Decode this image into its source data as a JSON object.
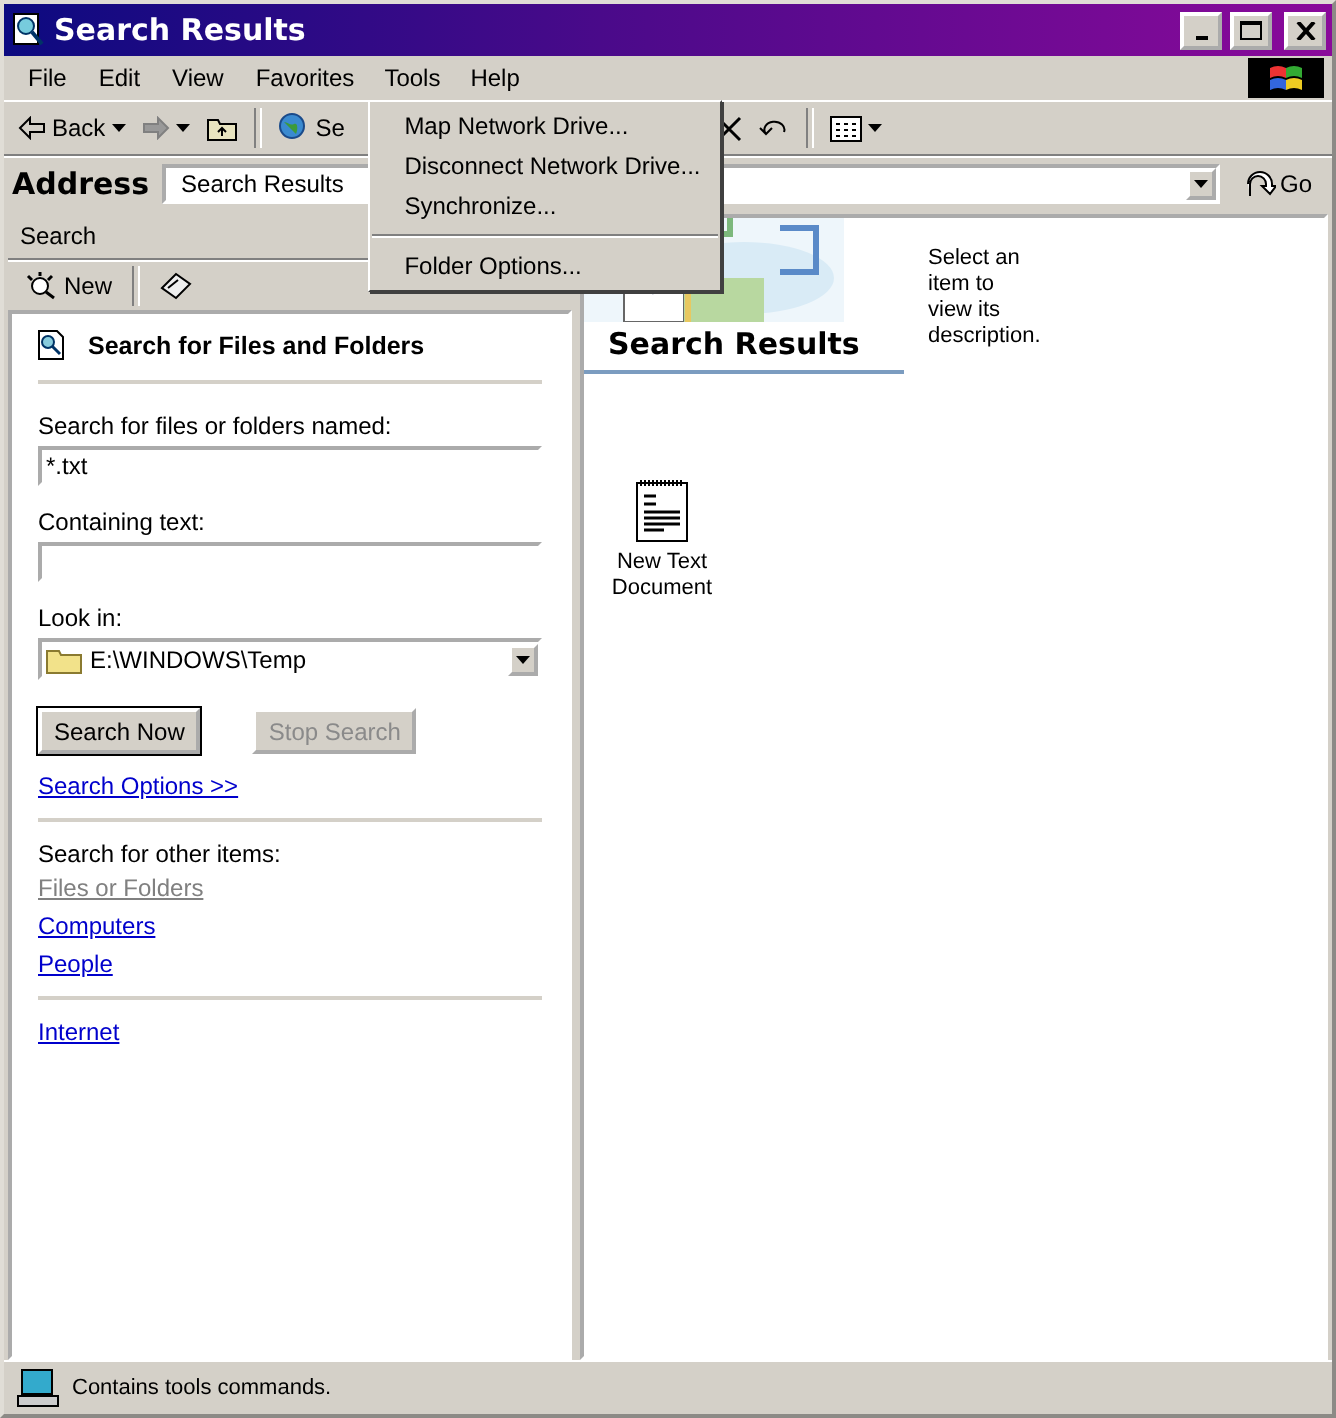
{
  "window": {
    "title": "Search Results"
  },
  "menu_bar": [
    {
      "label": "File",
      "selected": false
    },
    {
      "label": "Edit",
      "selected": false
    },
    {
      "label": "View",
      "selected": false
    },
    {
      "label": "Favorites",
      "selected": false
    },
    {
      "label": "Tools",
      "selected": true
    },
    {
      "label": "Help",
      "selected": false
    }
  ],
  "open_menu": {
    "items": [
      {
        "kind": "item",
        "label": "Map Network Drive..."
      },
      {
        "kind": "item",
        "label": "Disconnect Network Drive..."
      },
      {
        "kind": "item",
        "label": "Synchronize..."
      },
      {
        "kind": "separator"
      },
      {
        "kind": "item",
        "label": "Folder Options..."
      }
    ]
  },
  "toolbar": [
    {
      "kind": "back",
      "label": "Back",
      "disabled": false
    },
    {
      "kind": "forward",
      "disabled": true
    },
    {
      "kind": "up",
      "disabled": false
    },
    {
      "kind": "search",
      "label": "Se",
      "disabled": false
    },
    {
      "kind": "delete",
      "disabled": false
    },
    {
      "kind": "undo",
      "disabled": false
    },
    {
      "kind": "views",
      "disabled": false
    }
  ],
  "address": {
    "label": "Address",
    "value": "Search Results",
    "go": "Go"
  },
  "search_pane": {
    "title": "Search",
    "new_button": "New",
    "heading": "Search for Files and Folders",
    "fields": [
      {
        "label": "Search for files or folders named:",
        "value": "*.txt"
      },
      {
        "label": "Containing text:"
      }
    ],
    "look_in": {
      "label": "Look in:",
      "value": "E:\\WINDOWS\\Temp"
    },
    "buttons": [
      {
        "label": "Search Now",
        "disabled": false
      },
      {
        "label": "Stop Search",
        "disabled": true
      }
    ],
    "options_link": "Search Options >>",
    "other_label": "Search for other items:",
    "other_links": [
      {
        "label": "Files or Folders",
        "disabled": true
      },
      {
        "label": "Computers",
        "disabled": false
      },
      {
        "label": "People",
        "disabled": false
      }
    ],
    "internet_link": "Internet"
  },
  "results": {
    "title": "Search Results",
    "description": "Select an item to view its description.",
    "files": [
      {
        "name": "New Text Document"
      }
    ]
  },
  "status_bar": {
    "text": "Contains tools commands."
  }
}
